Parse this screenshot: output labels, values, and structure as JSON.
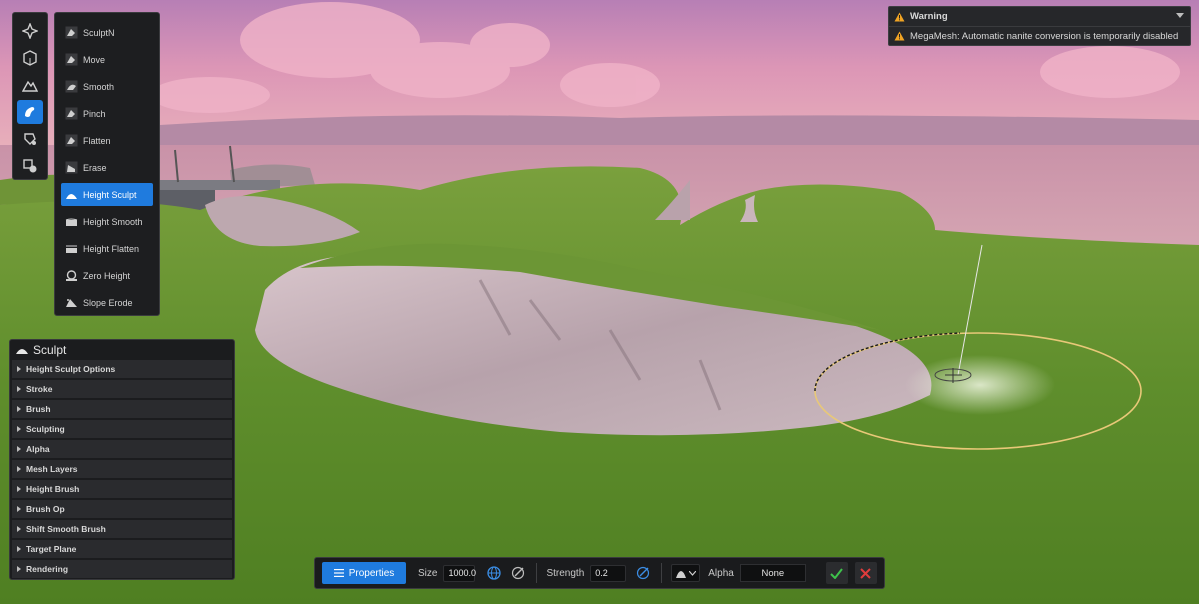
{
  "warning": {
    "title": "Warning",
    "message": "MegaMesh: Automatic nanite conversion is temporarily disabled",
    "icon": "warning-triangle-icon",
    "color": "#f0a424"
  },
  "modes": [
    {
      "icon": "select-mode-icon",
      "active": false
    },
    {
      "icon": "object-mode-icon",
      "active": false
    },
    {
      "icon": "landscape-mode-icon",
      "active": false
    },
    {
      "icon": "sculpt-mode-icon",
      "active": true
    },
    {
      "icon": "paint-mode-icon",
      "active": false
    },
    {
      "icon": "shapes-mode-icon",
      "active": false
    }
  ],
  "tools": [
    {
      "label": "SculptN",
      "icon": "sculpt-brush-icon",
      "active": false
    },
    {
      "label": "Move",
      "icon": "move-brush-icon",
      "active": false
    },
    {
      "label": "Smooth",
      "icon": "smooth-brush-icon",
      "active": false
    },
    {
      "label": "Pinch",
      "icon": "pinch-brush-icon",
      "active": false
    },
    {
      "label": "Flatten",
      "icon": "flatten-brush-icon",
      "active": false
    },
    {
      "label": "Erase",
      "icon": "erase-brush-icon",
      "active": false
    },
    {
      "label": "Height Sculpt",
      "icon": "height-sculpt-icon",
      "active": true
    },
    {
      "label": "Height Smooth",
      "icon": "height-smooth-icon",
      "active": false
    },
    {
      "label": "Height Flatten",
      "icon": "height-flatten-icon",
      "active": false
    },
    {
      "label": "Zero Height",
      "icon": "zero-height-icon",
      "active": false
    },
    {
      "label": "Slope Erode",
      "icon": "slope-erode-icon",
      "active": false
    }
  ],
  "sculpt_panel": {
    "title": "Sculpt",
    "sections": [
      "Height Sculpt Options",
      "Stroke",
      "Brush",
      "Sculpting",
      "Alpha",
      "Mesh Layers",
      "Height Brush",
      "Brush Op",
      "Shift Smooth Brush",
      "Target Plane",
      "Rendering"
    ]
  },
  "brush_bar": {
    "properties_label": "Properties",
    "size_label": "Size",
    "size_value": "1000.0",
    "strength_label": "Strength",
    "strength_value": "0.2",
    "alpha_label": "Alpha",
    "alpha_value": "None"
  },
  "colors": {
    "accent": "#1f7bde",
    "accept": "#3ec24b",
    "cancel": "#e03c3c",
    "brush_ring": "#e8c878"
  }
}
